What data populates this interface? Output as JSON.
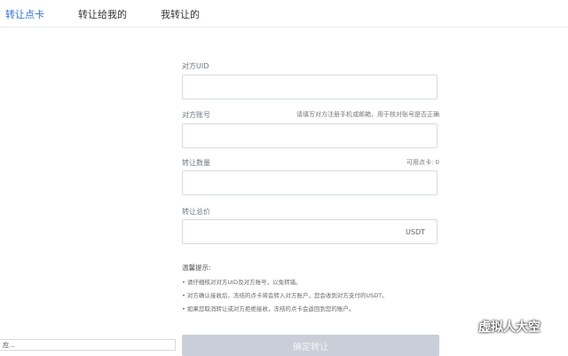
{
  "tabs": [
    {
      "label": "转让点卡",
      "active": true
    },
    {
      "label": "转让给我的",
      "active": false
    },
    {
      "label": "我转让的",
      "active": false
    }
  ],
  "form": {
    "uid_label": "对方UID",
    "uid_value": "",
    "account_label": "对方账号",
    "account_hint": "请填写对方注册手机或邮箱，用于核对账号是否正确",
    "account_value": "",
    "quantity_label": "转让数量",
    "quantity_available": "可用点卡: 0",
    "quantity_value": "",
    "price_label": "转让总价",
    "price_value": "",
    "price_unit": "USDT"
  },
  "tips": {
    "title": "温馨提示:",
    "items": [
      "• 请仔细核对对方UID及对方账号，以免转错。",
      "• 对方确认接收后，冻结的点卡将会转入对方账户，您会收到对方支付的USDT。",
      "• 如果您取消转让或对方拒绝接收，冻结的点卡会返回到您的账户。"
    ]
  },
  "submit_label": "确定转让",
  "bottom_input_value": "应...",
  "watermark": {
    "text": "虚拟人大空",
    "icon": "wechat-icon"
  },
  "colors": {
    "accent": "#2b6fd6",
    "button_disabled": "#c9ced8",
    "border": "#d6dbe3"
  }
}
